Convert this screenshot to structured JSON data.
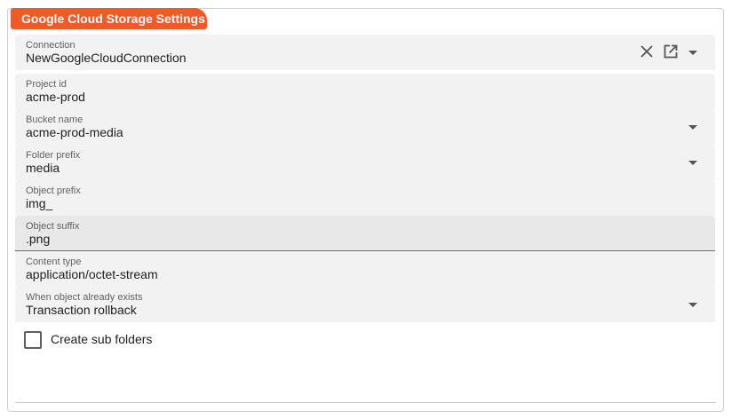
{
  "panel": {
    "title": "Google Cloud Storage Settings"
  },
  "fields": {
    "connection": {
      "label": "Connection",
      "value": "NewGoogleCloudConnection"
    },
    "project_id": {
      "label": "Project id",
      "value": "acme-prod"
    },
    "bucket_name": {
      "label": "Bucket name",
      "value": "acme-prod-media"
    },
    "folder_prefix": {
      "label": "Folder prefix",
      "value": "media"
    },
    "object_prefix": {
      "label": "Object prefix",
      "value": "img_"
    },
    "object_suffix": {
      "label": "Object suffix",
      "value": ".png"
    },
    "content_type": {
      "label": "Content type",
      "value": "application/octet-stream"
    },
    "when_exists": {
      "label": "When object already exists",
      "value": "Transaction rollback"
    }
  },
  "create_sub_folders": {
    "label": "Create sub folders",
    "checked": false
  },
  "icons": {
    "clear": "close-icon",
    "open": "open-in-new-icon",
    "dropdown": "chevron-down-icon"
  },
  "colors": {
    "accent": "#f05a28",
    "field_background": "#f2f2f2",
    "focused_field_background": "#e8e8e8"
  }
}
